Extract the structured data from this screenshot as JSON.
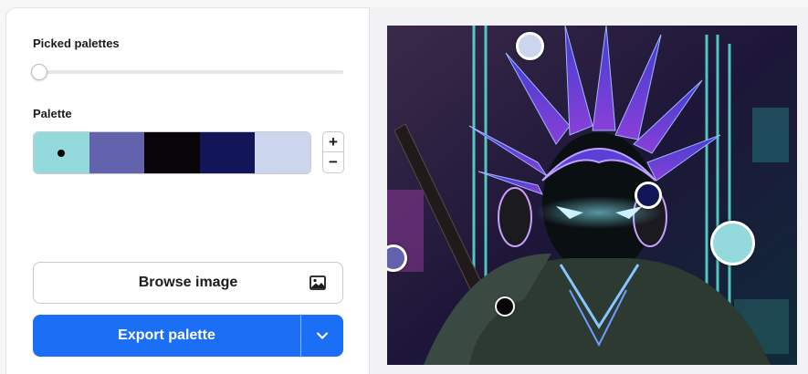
{
  "panel": {
    "picked_palettes_label": "Picked palettes",
    "picked_palettes_value": 0,
    "palette_label": "Palette",
    "plus_label": "+",
    "minus_label": "−"
  },
  "palette": {
    "colors": [
      "#94d9dc",
      "#6262ad",
      "#070507",
      "#131559",
      "#cbd6ee"
    ],
    "selected_index": 0
  },
  "actions": {
    "browse_label": "Browse image",
    "export_label": "Export palette"
  },
  "image": {
    "subject": "neon cyberpunk anime warrior illustration"
  },
  "theme": {
    "accent": "#1a6ff5"
  }
}
